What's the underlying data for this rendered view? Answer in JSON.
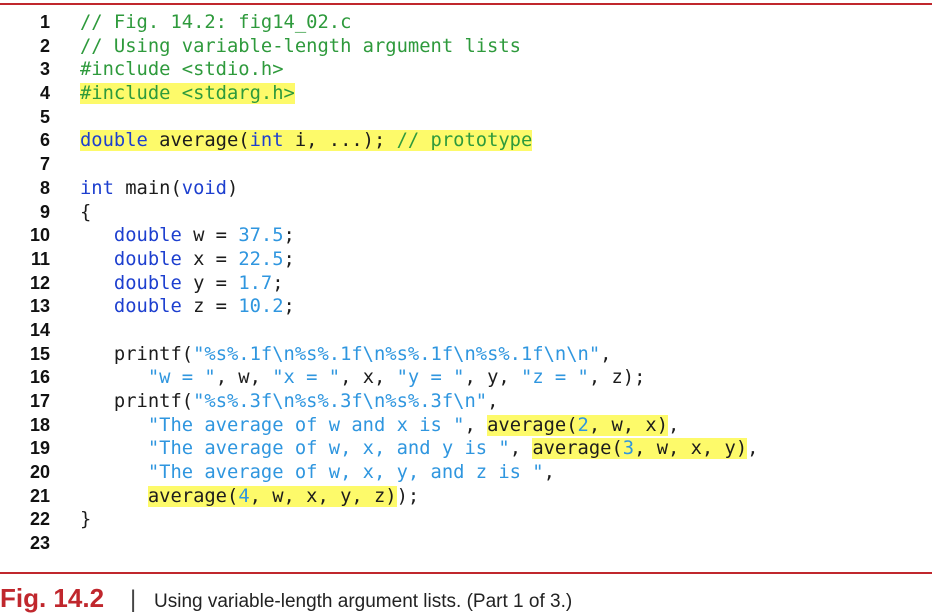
{
  "colors": {
    "rule": "#c0272d",
    "figure_label": "#c0272d",
    "highlight": "#fdfa6a",
    "text": "#1c1c1c",
    "comment": "#2e9a3c",
    "keyword": "#1d3fcf",
    "literal": "#2f96df"
  },
  "code": {
    "lines": [
      {
        "n": "1",
        "tokens": [
          {
            "t": "// Fig. 14.2: fig14_02.c",
            "c": "#2e9a3c"
          }
        ]
      },
      {
        "n": "2",
        "tokens": [
          {
            "t": "// Using variable-length argument lists",
            "c": "#2e9a3c"
          }
        ]
      },
      {
        "n": "3",
        "tokens": [
          {
            "t": "#include <stdio.h>",
            "c": "#2e9a3c"
          }
        ]
      },
      {
        "n": "4",
        "tokens": [
          {
            "t": "#include <stdarg.h>",
            "c": "#2e9a3c",
            "h": true
          }
        ]
      },
      {
        "n": "5",
        "tokens": []
      },
      {
        "n": "6",
        "tokens": [
          {
            "t": "double",
            "c": "#1d3fcf",
            "h": true
          },
          {
            "t": " average(",
            "h": true
          },
          {
            "t": "int",
            "c": "#1d3fcf",
            "h": true
          },
          {
            "t": " i, ...); ",
            "h": true
          },
          {
            "t": "// prototype",
            "c": "#2e9a3c",
            "h": true
          }
        ]
      },
      {
        "n": "7",
        "tokens": []
      },
      {
        "n": "8",
        "tokens": [
          {
            "t": "int",
            "c": "#1d3fcf"
          },
          {
            "t": " main("
          },
          {
            "t": "void",
            "c": "#1d3fcf"
          },
          {
            "t": ")"
          }
        ]
      },
      {
        "n": "9",
        "tokens": [
          {
            "t": "{"
          }
        ]
      },
      {
        "n": "10",
        "tokens": [
          {
            "t": "   "
          },
          {
            "t": "double",
            "c": "#1d3fcf"
          },
          {
            "t": " w = "
          },
          {
            "t": "37.5",
            "c": "#2f96df"
          },
          {
            "t": ";"
          }
        ]
      },
      {
        "n": "11",
        "tokens": [
          {
            "t": "   "
          },
          {
            "t": "double",
            "c": "#1d3fcf"
          },
          {
            "t": " x = "
          },
          {
            "t": "22.5",
            "c": "#2f96df"
          },
          {
            "t": ";"
          }
        ]
      },
      {
        "n": "12",
        "tokens": [
          {
            "t": "   "
          },
          {
            "t": "double",
            "c": "#1d3fcf"
          },
          {
            "t": " y = "
          },
          {
            "t": "1.7",
            "c": "#2f96df"
          },
          {
            "t": ";"
          }
        ]
      },
      {
        "n": "13",
        "tokens": [
          {
            "t": "   "
          },
          {
            "t": "double",
            "c": "#1d3fcf"
          },
          {
            "t": " z = "
          },
          {
            "t": "10.2",
            "c": "#2f96df"
          },
          {
            "t": ";"
          }
        ]
      },
      {
        "n": "14",
        "tokens": []
      },
      {
        "n": "15",
        "tokens": [
          {
            "t": "   printf("
          },
          {
            "t": "\"%s%.1f\\n%s%.1f\\n%s%.1f\\n%s%.1f\\n\\n\"",
            "c": "#2f96df"
          },
          {
            "t": ","
          }
        ]
      },
      {
        "n": "16",
        "tokens": [
          {
            "t": "      "
          },
          {
            "t": "\"w = \"",
            "c": "#2f96df"
          },
          {
            "t": ", w, "
          },
          {
            "t": "\"x = \"",
            "c": "#2f96df"
          },
          {
            "t": ", x, "
          },
          {
            "t": "\"y = \"",
            "c": "#2f96df"
          },
          {
            "t": ", y, "
          },
          {
            "t": "\"z = \"",
            "c": "#2f96df"
          },
          {
            "t": ", z);"
          }
        ]
      },
      {
        "n": "17",
        "tokens": [
          {
            "t": "   printf("
          },
          {
            "t": "\"%s%.3f\\n%s%.3f\\n%s%.3f\\n\"",
            "c": "#2f96df"
          },
          {
            "t": ","
          }
        ]
      },
      {
        "n": "18",
        "tokens": [
          {
            "t": "      "
          },
          {
            "t": "\"The average of w and x is \"",
            "c": "#2f96df"
          },
          {
            "t": ", "
          },
          {
            "t": "average(",
            "h": true
          },
          {
            "t": "2",
            "c": "#2f96df",
            "h": true
          },
          {
            "t": ", w, x)",
            "h": true
          },
          {
            "t": ","
          }
        ]
      },
      {
        "n": "19",
        "tokens": [
          {
            "t": "      "
          },
          {
            "t": "\"The average of w, x, and y is \"",
            "c": "#2f96df"
          },
          {
            "t": ", "
          },
          {
            "t": "average(",
            "h": true
          },
          {
            "t": "3",
            "c": "#2f96df",
            "h": true
          },
          {
            "t": ", w, x, y)",
            "h": true
          },
          {
            "t": ","
          }
        ]
      },
      {
        "n": "20",
        "tokens": [
          {
            "t": "      "
          },
          {
            "t": "\"The average of w, x, y, and z is \"",
            "c": "#2f96df"
          },
          {
            "t": ","
          }
        ]
      },
      {
        "n": "21",
        "tokens": [
          {
            "t": "      "
          },
          {
            "t": "average(",
            "h": true
          },
          {
            "t": "4",
            "c": "#2f96df",
            "h": true
          },
          {
            "t": ", w, x, y, z)",
            "h": true
          },
          {
            "t": ");"
          }
        ]
      },
      {
        "n": "22",
        "tokens": [
          {
            "t": "}"
          }
        ]
      },
      {
        "n": "23",
        "tokens": []
      }
    ]
  },
  "caption": {
    "label": "Fig. 14.2",
    "separator": "|",
    "text": "Using variable-length argument lists. (Part 1 of 3.)"
  }
}
